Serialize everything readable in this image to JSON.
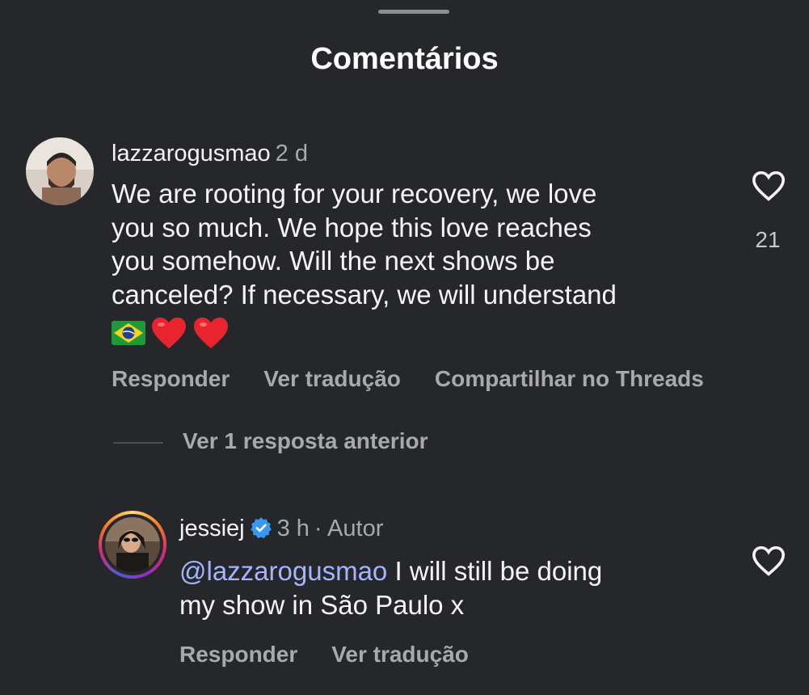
{
  "sheet": {
    "title": "Comentários"
  },
  "comments": [
    {
      "username": "lazzarogusmao",
      "time": "2 d",
      "text_lines": [
        "We are rooting for your recovery, we love",
        "you so much. We hope this love reaches",
        "you somehow. Will the next shows be",
        "canceled? If necessary, we will understand"
      ],
      "emoji_names": [
        "brazil-flag",
        "red-heart",
        "red-heart"
      ],
      "likes": "21",
      "actions": [
        "Responder",
        "Ver tradução",
        "Compartilhar no Threads"
      ]
    }
  ],
  "replies_link": "Ver 1 resposta anterior",
  "reply": {
    "username": "jessiej",
    "verified": true,
    "time": "3 h",
    "role": "· Autor",
    "mention": "@lazzarogusmao",
    "text_line1": " I will still be doing",
    "text_line2": "my show in São Paulo x",
    "actions": [
      "Responder",
      "Ver tradução"
    ]
  },
  "colors": {
    "background": "#25272b",
    "mention": "#a5b4fc",
    "verified": "#3897f0",
    "story_ring": "#d6249f"
  }
}
